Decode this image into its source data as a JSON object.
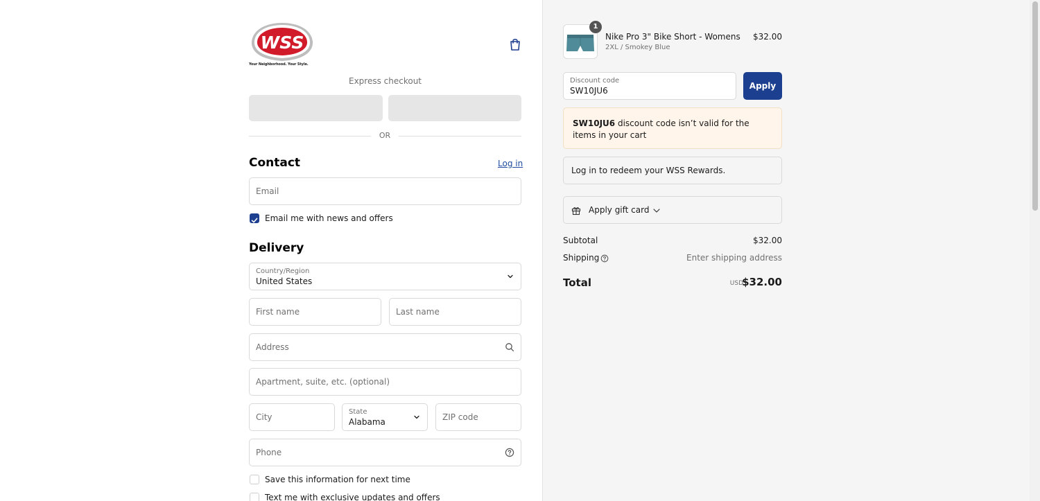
{
  "brand": {
    "logo_text": "WSS",
    "tagline": "Your Neighborhood. Your Style.",
    "colors": {
      "logo_red": "#d11a2a",
      "primary": "#1d3f8f",
      "link": "#1d4aa0"
    }
  },
  "header": {
    "cart_icon": "shopping-bag-icon"
  },
  "express": {
    "title": "Express checkout",
    "or_label": "OR"
  },
  "contact": {
    "heading": "Contact",
    "login_label": "Log in",
    "email_placeholder": "Email",
    "news_checkbox_label": "Email me with news and offers",
    "news_checked": true
  },
  "delivery": {
    "heading": "Delivery",
    "country_label": "Country/Region",
    "country_value": "United States",
    "first_name_placeholder": "First name",
    "last_name_placeholder": "Last name",
    "address_placeholder": "Address",
    "apartment_placeholder": "Apartment, suite, etc. (optional)",
    "city_placeholder": "City",
    "state_label": "State",
    "state_value": "Alabama",
    "zip_placeholder": "ZIP code",
    "phone_placeholder": "Phone",
    "save_info_label": "Save this information for next time",
    "text_me_label": "Text me with exclusive updates and offers"
  },
  "order": {
    "item": {
      "quantity": "1",
      "name": "Nike Pro 3\" Bike Short - Womens",
      "variant": "2XL / Smokey Blue",
      "price": "$32.00"
    },
    "discount": {
      "label": "Discount code",
      "value": "SW10JU6",
      "apply_label": "Apply",
      "error_code": "SW10JU6",
      "error_text": " discount code isn’t valid for the items in your cart"
    },
    "rewards_text": "Log in to redeem your WSS Rewards.",
    "gift_card_label": "Apply gift card",
    "subtotal_label": "Subtotal",
    "subtotal_value": "$32.00",
    "shipping_label": "Shipping",
    "shipping_value": "Enter shipping address",
    "total_label": "Total",
    "total_currency": "USD",
    "total_value": "$32.00"
  }
}
